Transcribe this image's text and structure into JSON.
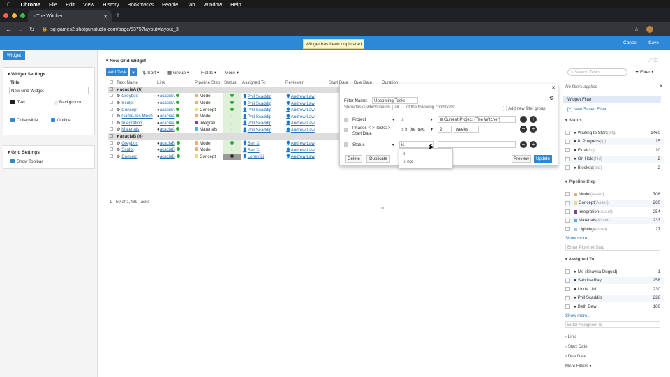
{
  "menubar": {
    "apple": "",
    "app": "Chrome",
    "items": [
      "File",
      "Edit",
      "View",
      "History",
      "Bookmarks",
      "People",
      "Tab",
      "Window",
      "Help"
    ]
  },
  "browser": {
    "tab_title": "◦ The Witcher",
    "url": "sg-games2.shotgunstudio.com/page/5375?layout=layout_3"
  },
  "topbar": {
    "toast": "Widget has been duplicated",
    "cancel": "Cancel",
    "save": "Save"
  },
  "left": {
    "tab": "Widget",
    "widget_settings": "Widget Settings",
    "title_label": "Title",
    "title_value": "New Grid Widget",
    "text": "Text",
    "background": "Background",
    "collapsible": "Collapsible",
    "outline": "Outline",
    "grid_settings": "Grid Settings",
    "show_toolbar": "Show Toolbar"
  },
  "grid": {
    "title": "New Grid Widget",
    "add_task": "Add Task",
    "sort": "Sort",
    "group": "Group",
    "fields": "Fields",
    "more": "More",
    "search_placeholder": "Search Tasks...",
    "filter": "Filter",
    "columns": [
      "Task Name",
      "Link",
      "Pipeline Step",
      "Status",
      "Assigned To",
      "Reviewer",
      "Start Date",
      "Due Date",
      "Duration"
    ],
    "footer": "1 - 50 of 1,489 Tasks",
    "groups": [
      {
        "name": "acaciaA (6)",
        "rows": [
          {
            "task": "Greybox",
            "link": "acaciaA",
            "step": "Model",
            "stepColor": "#e8b080",
            "status": "ok",
            "assigned": "Phil Scaddip",
            "reviewer": "Andrew Law"
          },
          {
            "task": "Sculpt",
            "link": "acaciaA",
            "step": "Model",
            "stepColor": "#e8b080",
            "status": "ok",
            "assigned": "Phil Scaddip",
            "reviewer": "Andrew Law"
          },
          {
            "task": "Concept",
            "link": "acaciaA",
            "step": "Concept",
            "stepColor": "#e8e080",
            "status": "ok",
            "assigned": "Phil Scaddip",
            "reviewer": "Andrew Law"
          },
          {
            "task": "Game-res Mesh",
            "link": "acaciaA",
            "step": "Model",
            "stepColor": "#e8b080",
            "status": "-",
            "assigned": "Phil Scaddip",
            "reviewer": "Andrew Law"
          },
          {
            "task": "Integration",
            "link": "acaciaA",
            "step": "Integrati",
            "stepColor": "#7a3fa0",
            "status": "-",
            "assigned": "Phil Scaddip",
            "reviewer": "Andrew Law"
          },
          {
            "task": "Materials",
            "link": "acaciaA",
            "step": "Materials",
            "stepColor": "#5ab0e0",
            "status": "-",
            "assigned": "Phil Scaddip",
            "reviewer": "Andrew Law"
          }
        ]
      },
      {
        "name": "acaciaB (6)",
        "rows": [
          {
            "task": "Greybox",
            "link": "acaciaB",
            "step": "Model",
            "stepColor": "#e8b080",
            "status": "ok",
            "assigned": "Ben X",
            "reviewer": "Andrew Law"
          },
          {
            "task": "Sculpt",
            "link": "acaciaB",
            "step": "Model",
            "stepColor": "#e8b080",
            "status": "-",
            "assigned": "Ben X",
            "reviewer": "Andrew Law"
          },
          {
            "task": "Concept",
            "link": "acaciaB",
            "step": "Concept",
            "stepColor": "#e8e080",
            "status": "dark",
            "assigned": "Loney Li",
            "reviewer": "Andrew Law"
          }
        ]
      }
    ]
  },
  "filter_popup": {
    "filter_name_label": "Filter Name:",
    "filter_name_value": "Upcoming Tasks",
    "show_tasks": "Show tasks which match",
    "all": "all",
    "of_following": "of the following conditions:",
    "add_group": "[+] Add new filter group",
    "row1_field": "Project",
    "row1_op": "is",
    "row1_val": "Current Project (The Witcher)",
    "row2_field": "Phases <-> Tasks > Start Date",
    "row2_op": "is in the next",
    "row2_num": "2",
    "row2_unit": "weeks",
    "row3_field": "Status",
    "row3_op": "is",
    "delete": "Delete",
    "duplicate": "Duplicate",
    "preview": "Preview",
    "update": "Update",
    "dropdown": [
      "is",
      "is not"
    ]
  },
  "right": {
    "no_filters": "No filters applied",
    "widget_filter": "Widget Filter",
    "new_saved": "[+] New Saved Filter",
    "status_title": "Status",
    "status": [
      {
        "label": "Waiting to Start",
        "code": "(wtg)",
        "count": "1460"
      },
      {
        "label": "In Progress",
        "code": "(ip)",
        "count": "15"
      },
      {
        "label": "Final",
        "code": "(fin)",
        "count": "10"
      },
      {
        "label": "On Hold",
        "code": "(hld)",
        "count": "2"
      },
      {
        "label": "Blocked",
        "code": "(bld)",
        "count": "2"
      }
    ],
    "pipeline_title": "Pipeline Step",
    "pipeline": [
      {
        "label": "Model",
        "code": "(Asset)",
        "count": "708",
        "color": "#e8b080"
      },
      {
        "label": "Concept",
        "code": "(Asset)",
        "count": "260",
        "color": "#e8e080"
      },
      {
        "label": "Integration",
        "code": "(Asset)",
        "count": "254",
        "color": "#7a3fa0"
      },
      {
        "label": "Materials",
        "code": "(Asset)",
        "count": "233",
        "color": "#5ab0e0"
      },
      {
        "label": "Lighting",
        "code": "(Asset)",
        "count": "27",
        "color": "#a0c8f0"
      }
    ],
    "show_more": "Show more...",
    "enter_pipeline": "Enter Pipeline Step",
    "assigned_title": "Assigned To",
    "assigned": [
      {
        "label": "Me (Shayna Duguid)",
        "count": "1"
      },
      {
        "label": "Sabrina Ray",
        "count": "258"
      },
      {
        "label": "Linda Uld",
        "count": "230"
      },
      {
        "label": "Phil Scaddip",
        "count": "228"
      },
      {
        "label": "Beth Dew",
        "count": "100"
      }
    ],
    "show_more2": "Show more...",
    "enter_assigned": "Enter Assigned To",
    "link": "Link",
    "start_date": "Start Date",
    "due_date": "Due Date",
    "more_filters": "More Filters"
  }
}
